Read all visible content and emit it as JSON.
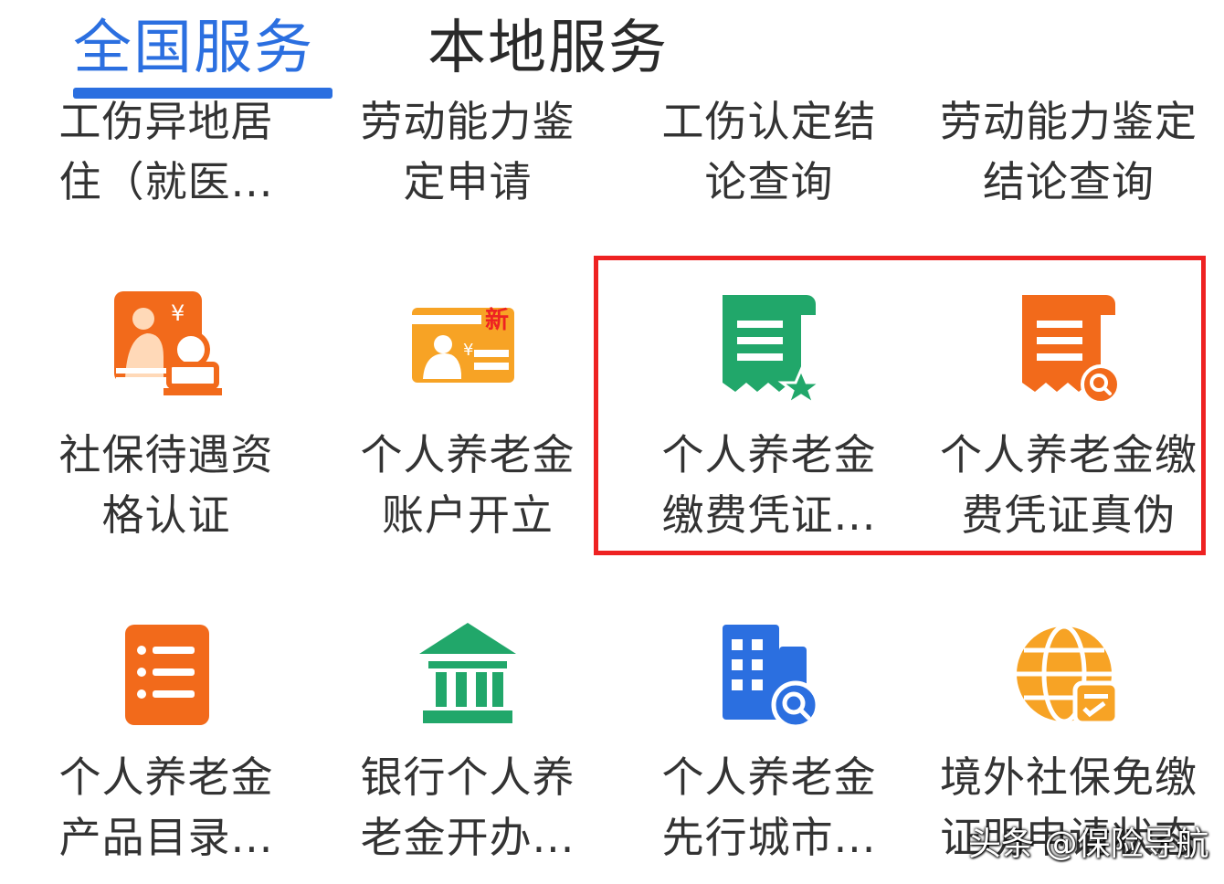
{
  "tabs": {
    "national": "全国服务",
    "local": "本地服务"
  },
  "colors": {
    "accent": "#2b6fe0",
    "highlight": "#ee2222",
    "orange": "#f26a1b",
    "green": "#21a76a",
    "blue": "#2b6fe0"
  },
  "services": {
    "row1": [
      {
        "line1": "工伤异地居",
        "line2": "住（就医..."
      },
      {
        "line1": "劳动能力鉴",
        "line2": "定申请"
      },
      {
        "line1": "工伤认定结",
        "line2": "论查询"
      },
      {
        "line1": "劳动能力鉴定",
        "line2": "结论查询"
      }
    ],
    "row2": [
      {
        "line1": "社保待遇资",
        "line2": "格认证",
        "icon": "elderly-certification-icon",
        "badge": "¥"
      },
      {
        "line1": "个人养老金",
        "line2": "账户开立",
        "icon": "new-account-card-icon",
        "badge": "新",
        "badge2": "¥"
      },
      {
        "line1": "个人养老金",
        "line2": "缴费凭证...",
        "icon": "receipt-star-icon"
      },
      {
        "line1": "个人养老金缴",
        "line2": "费凭证真伪",
        "icon": "receipt-search-icon"
      }
    ],
    "row3": [
      {
        "line1": "个人养老金",
        "line2": "产品目录...",
        "icon": "list-document-icon"
      },
      {
        "line1": "银行个人养",
        "line2": "老金开办...",
        "icon": "bank-building-icon"
      },
      {
        "line1": "个人养老金",
        "line2": "先行城市...",
        "icon": "city-search-icon"
      },
      {
        "line1": "境外社保免缴",
        "line2": "证明申请状态",
        "icon": "globe-document-icon"
      }
    ]
  },
  "watermark": "头条 @保险导航"
}
